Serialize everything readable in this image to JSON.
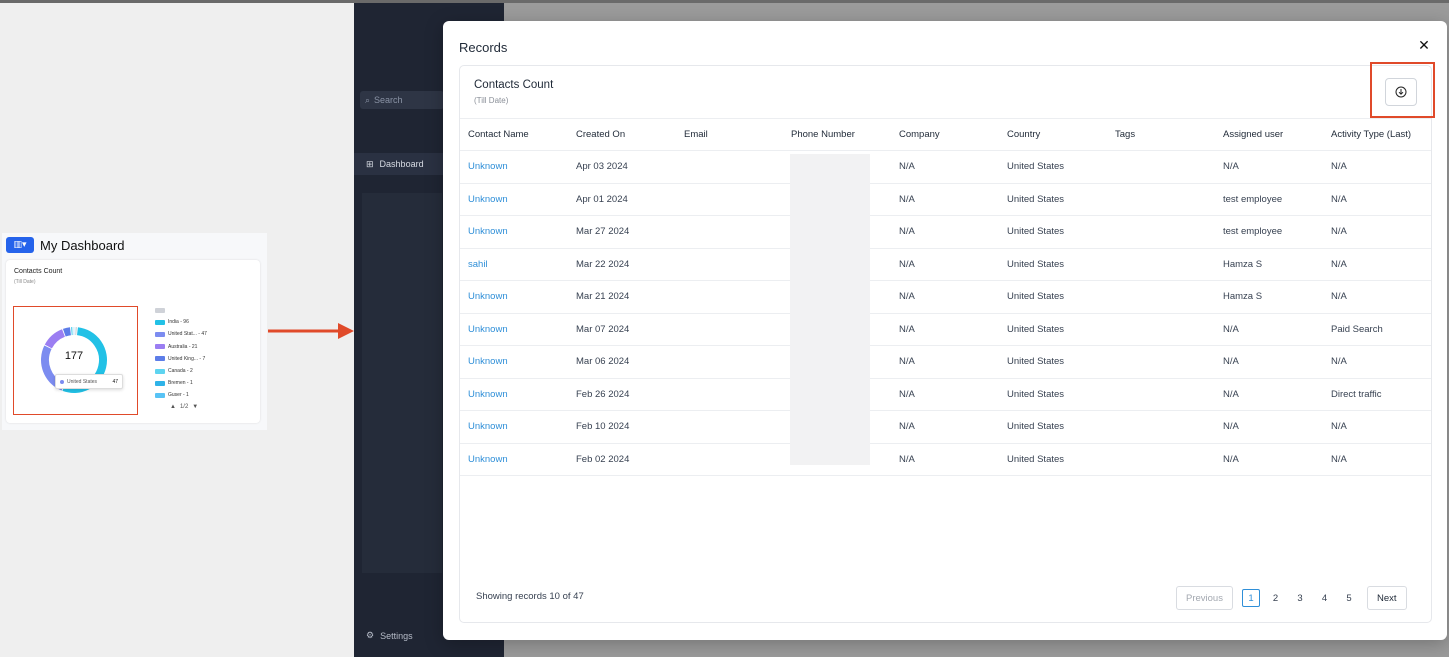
{
  "thumbnail": {
    "dashboard_title": "My Dashboard",
    "switch_icon": "layout-switch-icon",
    "card_title": "Contacts Count",
    "card_subtitle": "(Till Date)",
    "donut_total": "177",
    "tooltip": {
      "label": "United States",
      "value": "47"
    },
    "legend": [
      {
        "label": "",
        "color": "#cfd2d8"
      },
      {
        "label": "India - 96",
        "color": "#22c1e6"
      },
      {
        "label": "United Stat... - 47",
        "color": "#7c8cf0"
      },
      {
        "label": "Australia - 21",
        "color": "#9b7ef2"
      },
      {
        "label": "United King... - 7",
        "color": "#5d7de8"
      },
      {
        "label": "Canada - 2",
        "color": "#5ed4f0"
      },
      {
        "label": "Bremen - 1",
        "color": "#2fb3e8"
      },
      {
        "label": "Guser - 1",
        "color": "#58c3f5"
      }
    ],
    "legend_page": "1/2",
    "donut_values": [
      96,
      47,
      21,
      7,
      2,
      1,
      1,
      2
    ]
  },
  "sidebar": {
    "search_placeholder": "Search",
    "dashboard_label": "Dashboard",
    "settings_label": "Settings"
  },
  "modal": {
    "title": "Records",
    "card_title": "Contacts Count",
    "card_subtitle": "(Till Date)",
    "columns": [
      "Contact Name",
      "Created On",
      "Email",
      "Phone Number",
      "Company",
      "Country",
      "Tags",
      "Assigned user",
      "Activity Type (Last)"
    ],
    "rows": [
      {
        "name": "Unknown",
        "created": "Apr 03 2024",
        "email": "",
        "phone": "",
        "company": "N/A",
        "country": "United States",
        "tags": "",
        "assigned": "N/A",
        "activity": "N/A"
      },
      {
        "name": "Unknown",
        "created": "Apr 01 2024",
        "email": "",
        "phone": "",
        "company": "N/A",
        "country": "United States",
        "tags": "",
        "assigned": "test employee",
        "activity": "N/A"
      },
      {
        "name": "Unknown",
        "created": "Mar 27 2024",
        "email": "",
        "phone": "",
        "company": "N/A",
        "country": "United States",
        "tags": "",
        "assigned": "test employee",
        "activity": "N/A"
      },
      {
        "name": "sahil",
        "created": "Mar 22 2024",
        "email": "",
        "phone": "",
        "company": "N/A",
        "country": "United States",
        "tags": "",
        "assigned": "Hamza S",
        "activity": "N/A"
      },
      {
        "name": "Unknown",
        "created": "Mar 21 2024",
        "email": "",
        "phone": "",
        "company": "N/A",
        "country": "United States",
        "tags": "",
        "assigned": "Hamza S",
        "activity": "N/A"
      },
      {
        "name": "Unknown",
        "created": "Mar 07 2024",
        "email": "",
        "phone": "",
        "company": "N/A",
        "country": "United States",
        "tags": "",
        "assigned": "N/A",
        "activity": "Paid Search"
      },
      {
        "name": "Unknown",
        "created": "Mar 06 2024",
        "email": "",
        "phone": "",
        "company": "N/A",
        "country": "United States",
        "tags": "",
        "assigned": "N/A",
        "activity": "N/A"
      },
      {
        "name": "Unknown",
        "created": "Feb 26 2024",
        "email": "",
        "phone": "",
        "company": "N/A",
        "country": "United States",
        "tags": "",
        "assigned": "N/A",
        "activity": "Direct traffic"
      },
      {
        "name": "Unknown",
        "created": "Feb 10 2024",
        "email": "",
        "phone": "",
        "company": "N/A",
        "country": "United States",
        "tags": "",
        "assigned": "N/A",
        "activity": "N/A"
      },
      {
        "name": "Unknown",
        "created": "Feb 02 2024",
        "email": "",
        "phone": "",
        "company": "N/A",
        "country": "United States",
        "tags": "",
        "assigned": "N/A",
        "activity": "N/A"
      }
    ],
    "footer": {
      "showing": "Showing records 10 of 47",
      "previous": "Previous",
      "next": "Next",
      "pages": [
        "1",
        "2",
        "3",
        "4",
        "5"
      ],
      "current_page": "1"
    }
  },
  "colors": {
    "link": "#2f8fd8",
    "highlight": "#e04a2a",
    "sidebar_bg": "#1f2533"
  }
}
